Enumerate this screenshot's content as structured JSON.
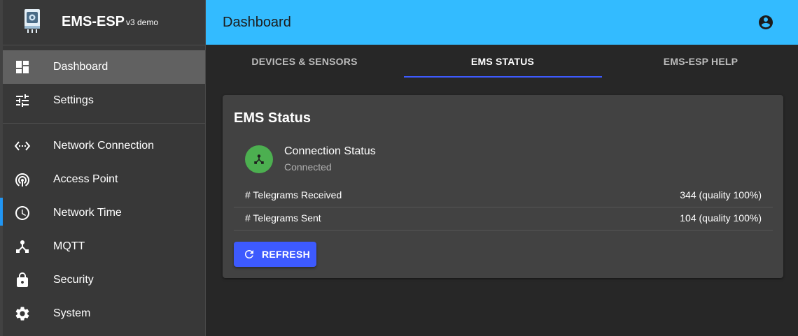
{
  "brand": {
    "title": "EMS-ESP",
    "subtitle": "v3 demo",
    "logo_icon": "ems-esp-device-logo"
  },
  "nav": {
    "items": [
      {
        "label": "Dashboard",
        "icon": "dashboard-icon",
        "active": true
      },
      {
        "label": "Settings",
        "icon": "tune-icon",
        "active": false
      },
      {
        "label": "Network Connection",
        "icon": "settings-ethernet-icon",
        "active": false
      },
      {
        "label": "Access Point",
        "icon": "wifi-tethering-icon",
        "active": false
      },
      {
        "label": "Network Time",
        "icon": "clock-icon",
        "active": false
      },
      {
        "label": "MQTT",
        "icon": "device-hub-icon",
        "active": false
      },
      {
        "label": "Security",
        "icon": "lock-icon",
        "active": false
      },
      {
        "label": "System",
        "icon": "gear-icon",
        "active": false
      }
    ]
  },
  "appbar": {
    "title": "Dashboard",
    "account_icon": "account-circle-icon"
  },
  "tabs": [
    {
      "label": "DEVICES & SENSORS",
      "active": false
    },
    {
      "label": "EMS STATUS",
      "active": true
    },
    {
      "label": "EMS-ESP HELP",
      "active": false
    }
  ],
  "card": {
    "title": "EMS Status",
    "connection": {
      "primary": "Connection Status",
      "secondary": "Connected",
      "icon": "device-hub-icon"
    },
    "rows": [
      {
        "label": "# Telegrams Received",
        "value": "344 (quality 100%)"
      },
      {
        "label": "# Telegrams Sent",
        "value": "104 (quality 100%)"
      }
    ],
    "refresh_label": "REFRESH",
    "refresh_icon": "refresh-icon"
  },
  "colors": {
    "appbar": "#33bbff",
    "accent": "#3d5afe",
    "status_ok": "#4caf50",
    "sidebar": "#383838",
    "background": "#272727",
    "card": "#424242"
  }
}
